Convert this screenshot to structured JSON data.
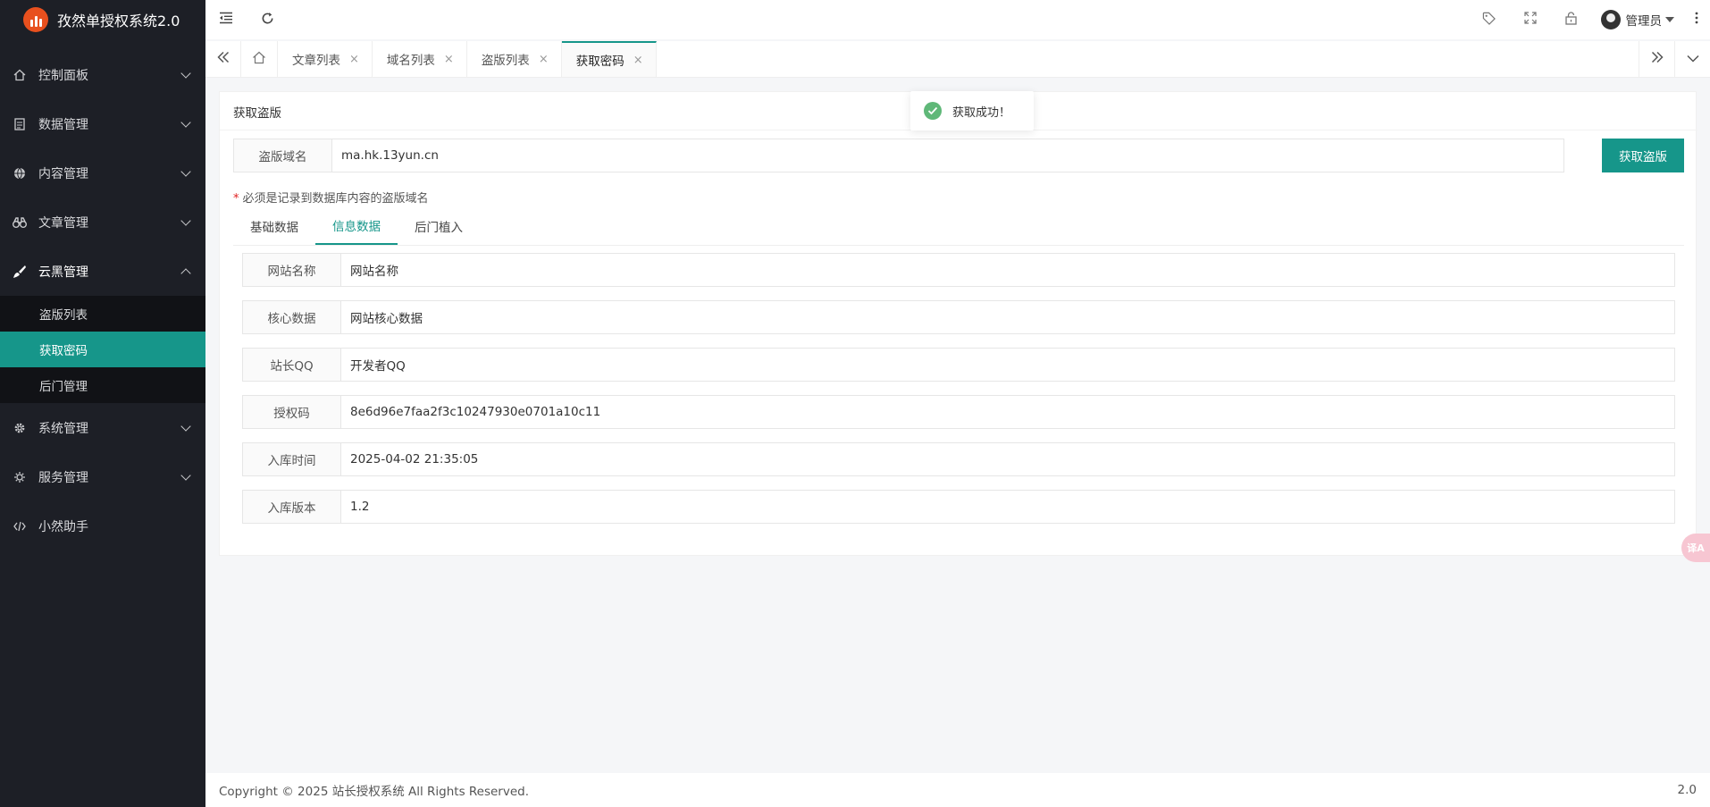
{
  "app": {
    "title": "孜然单授权系统2.0"
  },
  "sidebar": {
    "items": [
      {
        "label": "控制面板",
        "icon": "home-icon"
      },
      {
        "label": "数据管理",
        "icon": "document-icon"
      },
      {
        "label": "内容管理",
        "icon": "globe-icon"
      },
      {
        "label": "文章管理",
        "icon": "binoculars-icon"
      },
      {
        "label": "云黑管理",
        "icon": "brush-icon"
      },
      {
        "label": "系统管理",
        "icon": "gear-icon"
      },
      {
        "label": "服务管理",
        "icon": "settings-icon"
      },
      {
        "label": "小然助手",
        "icon": "code-icon"
      }
    ],
    "submenu": [
      "盗版列表",
      "获取密码",
      "后门管理"
    ]
  },
  "header": {
    "user": "管理员"
  },
  "tabs": {
    "items": [
      "文章列表",
      "域名列表",
      "盗版列表",
      "获取密码"
    ],
    "close": "×"
  },
  "card": {
    "title": "获取盗版",
    "domain_label": "盗版域名",
    "domain_value": "ma.hk.13yun.cn",
    "button": "获取盗版",
    "hint_star": "*",
    "hint": "必须是记录到数据库内容的盗版域名",
    "info_tabs": [
      "基础数据",
      "信息数据",
      "后门植入"
    ],
    "rows": [
      {
        "label": "网站名称",
        "value": "网站名称"
      },
      {
        "label": "核心数据",
        "value": "网站核心数据"
      },
      {
        "label": "站长QQ",
        "value": "开发者QQ"
      },
      {
        "label": "授权码",
        "value": "8e6d96e7faa2f3c10247930e0701a10c11"
      },
      {
        "label": "入库时间",
        "value": "2025-04-02 21:35:05"
      },
      {
        "label": "入库版本",
        "value": "1.2"
      }
    ]
  },
  "toast": {
    "message": "获取成功！"
  },
  "float_button": {
    "label": "译A"
  },
  "footer": {
    "copyright": "Copyright © 2025 站长授权系统 All Rights Reserved.",
    "version": "2.0"
  },
  "colors": {
    "accent": "#16968a",
    "sidebar": "#1d1f26",
    "submenu": "#111216",
    "logo": "#e8501e"
  }
}
